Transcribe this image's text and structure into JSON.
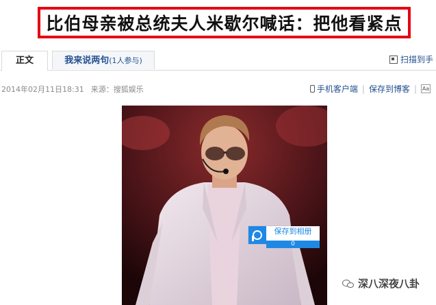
{
  "headline": "比伯母亲被总统夫人米歇尔喊话：把他看紧点",
  "tabs": [
    {
      "label": "正文"
    },
    {
      "label": "我来说两句",
      "sub": "(1人参与)"
    }
  ],
  "scan_link": "扫描到手",
  "meta": {
    "datetime": "2014年02月11日18:31",
    "source": "来源：搜狐娱乐"
  },
  "tools": {
    "mobile_client": "手机客户端",
    "save_blog": "保存到博客",
    "font_label": "Aa"
  },
  "photo_overlay": {
    "save_label": "保存到相册",
    "count": "0"
  },
  "watermark": "深八深夜八卦",
  "colors": {
    "headline_border": "#e60012",
    "link": "#24508f",
    "overlay_blue": "#1e88e5"
  }
}
